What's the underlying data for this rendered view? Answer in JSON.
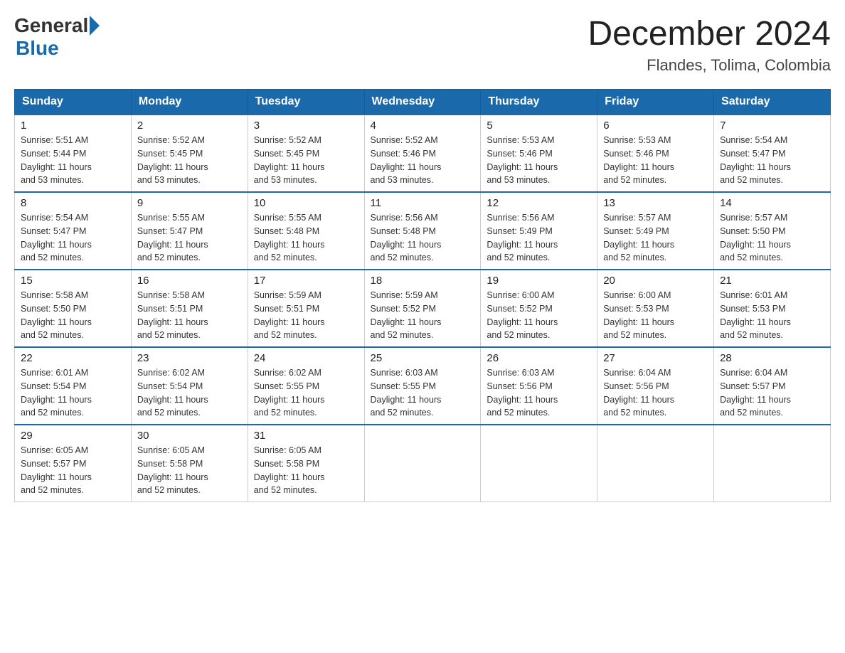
{
  "header": {
    "logo_general": "General",
    "logo_blue": "Blue",
    "month_title": "December 2024",
    "location": "Flandes, Tolima, Colombia"
  },
  "days_of_week": [
    "Sunday",
    "Monday",
    "Tuesday",
    "Wednesday",
    "Thursday",
    "Friday",
    "Saturday"
  ],
  "weeks": [
    [
      {
        "day": "1",
        "sunrise": "5:51 AM",
        "sunset": "5:44 PM",
        "daylight": "11 hours and 53 minutes."
      },
      {
        "day": "2",
        "sunrise": "5:52 AM",
        "sunset": "5:45 PM",
        "daylight": "11 hours and 53 minutes."
      },
      {
        "day": "3",
        "sunrise": "5:52 AM",
        "sunset": "5:45 PM",
        "daylight": "11 hours and 53 minutes."
      },
      {
        "day": "4",
        "sunrise": "5:52 AM",
        "sunset": "5:46 PM",
        "daylight": "11 hours and 53 minutes."
      },
      {
        "day": "5",
        "sunrise": "5:53 AM",
        "sunset": "5:46 PM",
        "daylight": "11 hours and 53 minutes."
      },
      {
        "day": "6",
        "sunrise": "5:53 AM",
        "sunset": "5:46 PM",
        "daylight": "11 hours and 52 minutes."
      },
      {
        "day": "7",
        "sunrise": "5:54 AM",
        "sunset": "5:47 PM",
        "daylight": "11 hours and 52 minutes."
      }
    ],
    [
      {
        "day": "8",
        "sunrise": "5:54 AM",
        "sunset": "5:47 PM",
        "daylight": "11 hours and 52 minutes."
      },
      {
        "day": "9",
        "sunrise": "5:55 AM",
        "sunset": "5:47 PM",
        "daylight": "11 hours and 52 minutes."
      },
      {
        "day": "10",
        "sunrise": "5:55 AM",
        "sunset": "5:48 PM",
        "daylight": "11 hours and 52 minutes."
      },
      {
        "day": "11",
        "sunrise": "5:56 AM",
        "sunset": "5:48 PM",
        "daylight": "11 hours and 52 minutes."
      },
      {
        "day": "12",
        "sunrise": "5:56 AM",
        "sunset": "5:49 PM",
        "daylight": "11 hours and 52 minutes."
      },
      {
        "day": "13",
        "sunrise": "5:57 AM",
        "sunset": "5:49 PM",
        "daylight": "11 hours and 52 minutes."
      },
      {
        "day": "14",
        "sunrise": "5:57 AM",
        "sunset": "5:50 PM",
        "daylight": "11 hours and 52 minutes."
      }
    ],
    [
      {
        "day": "15",
        "sunrise": "5:58 AM",
        "sunset": "5:50 PM",
        "daylight": "11 hours and 52 minutes."
      },
      {
        "day": "16",
        "sunrise": "5:58 AM",
        "sunset": "5:51 PM",
        "daylight": "11 hours and 52 minutes."
      },
      {
        "day": "17",
        "sunrise": "5:59 AM",
        "sunset": "5:51 PM",
        "daylight": "11 hours and 52 minutes."
      },
      {
        "day": "18",
        "sunrise": "5:59 AM",
        "sunset": "5:52 PM",
        "daylight": "11 hours and 52 minutes."
      },
      {
        "day": "19",
        "sunrise": "6:00 AM",
        "sunset": "5:52 PM",
        "daylight": "11 hours and 52 minutes."
      },
      {
        "day": "20",
        "sunrise": "6:00 AM",
        "sunset": "5:53 PM",
        "daylight": "11 hours and 52 minutes."
      },
      {
        "day": "21",
        "sunrise": "6:01 AM",
        "sunset": "5:53 PM",
        "daylight": "11 hours and 52 minutes."
      }
    ],
    [
      {
        "day": "22",
        "sunrise": "6:01 AM",
        "sunset": "5:54 PM",
        "daylight": "11 hours and 52 minutes."
      },
      {
        "day": "23",
        "sunrise": "6:02 AM",
        "sunset": "5:54 PM",
        "daylight": "11 hours and 52 minutes."
      },
      {
        "day": "24",
        "sunrise": "6:02 AM",
        "sunset": "5:55 PM",
        "daylight": "11 hours and 52 minutes."
      },
      {
        "day": "25",
        "sunrise": "6:03 AM",
        "sunset": "5:55 PM",
        "daylight": "11 hours and 52 minutes."
      },
      {
        "day": "26",
        "sunrise": "6:03 AM",
        "sunset": "5:56 PM",
        "daylight": "11 hours and 52 minutes."
      },
      {
        "day": "27",
        "sunrise": "6:04 AM",
        "sunset": "5:56 PM",
        "daylight": "11 hours and 52 minutes."
      },
      {
        "day": "28",
        "sunrise": "6:04 AM",
        "sunset": "5:57 PM",
        "daylight": "11 hours and 52 minutes."
      }
    ],
    [
      {
        "day": "29",
        "sunrise": "6:05 AM",
        "sunset": "5:57 PM",
        "daylight": "11 hours and 52 minutes."
      },
      {
        "day": "30",
        "sunrise": "6:05 AM",
        "sunset": "5:58 PM",
        "daylight": "11 hours and 52 minutes."
      },
      {
        "day": "31",
        "sunrise": "6:05 AM",
        "sunset": "5:58 PM",
        "daylight": "11 hours and 52 minutes."
      },
      null,
      null,
      null,
      null
    ]
  ],
  "labels": {
    "sunrise": "Sunrise: ",
    "sunset": "Sunset: ",
    "daylight": "Daylight: "
  }
}
